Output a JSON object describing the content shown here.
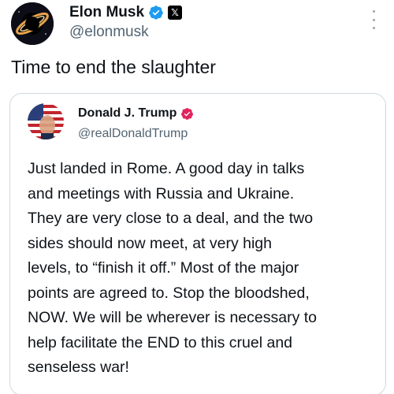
{
  "post": {
    "author_name": "Elon Musk",
    "author_handle": "@elonmusk",
    "text": "Time to end the slaughter",
    "colors": {
      "verified": "#1d9bf0",
      "badge": "#000000"
    },
    "icons": {
      "verified": "verified-check-icon",
      "affiliate": "x-logo-icon",
      "more": "more-vertical-icon"
    },
    "affiliate_badge_glyph": "𝕏"
  },
  "quoted_post": {
    "author_name": "Donald J. Trump",
    "author_handle": "@realDonaldTrump",
    "verified_color": "#e0245e",
    "lines": [
      "Just landed in Rome. A good day in talks",
      "and meetings with Russia and Ukraine.",
      "They are very close to a deal, and the two",
      "sides should now meet, at very high",
      "levels, to “finish it off.” Most of the major",
      "points are agreed to. Stop the bloodshed,",
      "NOW. We will be wherever is necessary to",
      "help facilitate the END to this cruel and",
      "senseless war!"
    ]
  }
}
